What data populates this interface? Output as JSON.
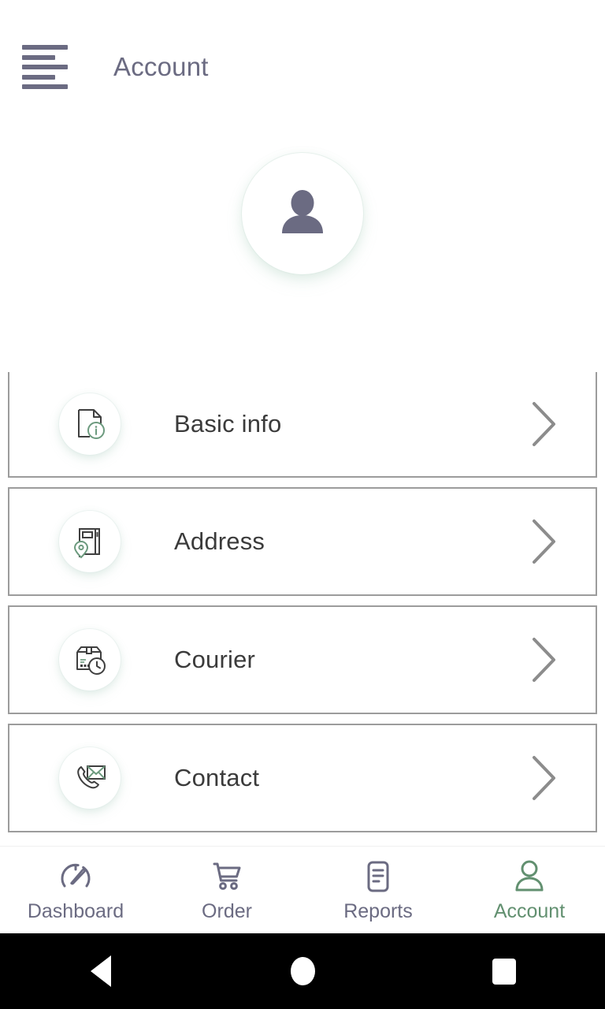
{
  "header": {
    "menu_icon": "hamburger-menu-icon",
    "title": "Account"
  },
  "profile": {
    "avatar_icon": "person-avatar-icon"
  },
  "menu_items": [
    {
      "label": "Basic info",
      "icon": "document-info-icon",
      "chevron": "chevron-right-icon"
    },
    {
      "label": "Address",
      "icon": "address-book-pin-icon",
      "chevron": "chevron-right-icon"
    },
    {
      "label": "Courier",
      "icon": "package-clock-icon",
      "chevron": "chevron-right-icon"
    },
    {
      "label": "Contact",
      "icon": "phone-envelope-icon",
      "chevron": "chevron-right-icon"
    }
  ],
  "bottom_nav": {
    "items": [
      {
        "label": "Dashboard",
        "icon": "speedometer-icon",
        "active": false
      },
      {
        "label": "Order",
        "icon": "shopping-cart-icon",
        "active": false
      },
      {
        "label": "Reports",
        "icon": "report-document-icon",
        "active": false
      },
      {
        "label": "Account",
        "icon": "person-icon",
        "active": true
      }
    ]
  },
  "system_bar": {
    "back": "back-triangle-icon",
    "home": "home-circle-icon",
    "recents": "recents-square-icon"
  },
  "colors": {
    "primary_text": "#6b6b82",
    "body_text": "#3b3b3b",
    "accent_green": "#629070",
    "border_gray": "#9c9c9c",
    "icon_dark": "#3f3f3f",
    "background": "#ffffff"
  }
}
